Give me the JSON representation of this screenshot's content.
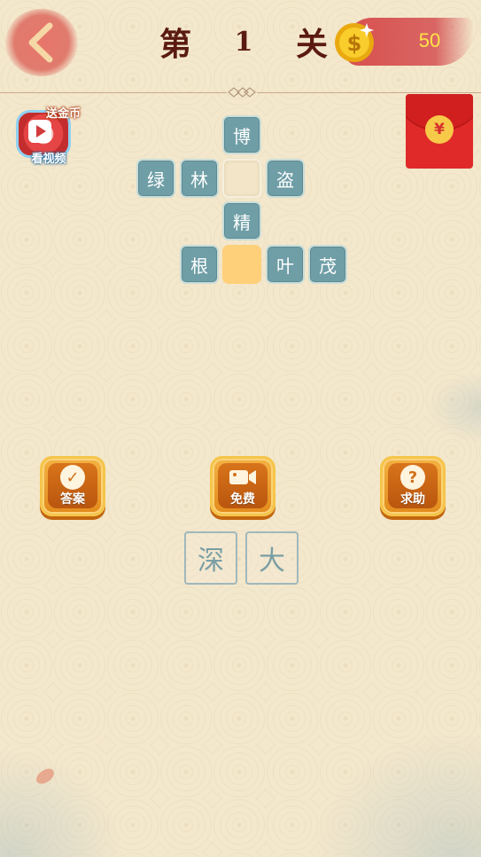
{
  "header": {
    "title_prefix": "第",
    "level": "1",
    "title_suffix": "关",
    "coins": "50"
  },
  "video_reward": {
    "tag": "送金币",
    "caption": "看视频"
  },
  "red_envelope": {
    "symbol": "¥"
  },
  "grid": {
    "cells": [
      {
        "id": "r0c2",
        "text": "博",
        "state": "filled"
      },
      {
        "id": "r1c0",
        "text": "绿",
        "state": "filled"
      },
      {
        "id": "r1c1",
        "text": "林",
        "state": "filled"
      },
      {
        "id": "r1c2",
        "text": "",
        "state": "empty"
      },
      {
        "id": "r1c3",
        "text": "盗",
        "state": "filled"
      },
      {
        "id": "r2c2",
        "text": "精",
        "state": "filled"
      },
      {
        "id": "r3c1",
        "text": "根",
        "state": "filled"
      },
      {
        "id": "r3c2",
        "text": "",
        "state": "selected"
      },
      {
        "id": "r3c3",
        "text": "叶",
        "state": "filled"
      },
      {
        "id": "r3c4",
        "text": "茂",
        "state": "filled"
      }
    ]
  },
  "actions": {
    "answer": "答案",
    "free": "免费",
    "help": "求助"
  },
  "candidates": [
    "深",
    "大"
  ],
  "colors": {
    "background": "#f3e7cc",
    "tile": "#6f9ea6",
    "selected": "#ffd07a",
    "title": "#5a1a12",
    "coin_text": "#ffe24a"
  }
}
